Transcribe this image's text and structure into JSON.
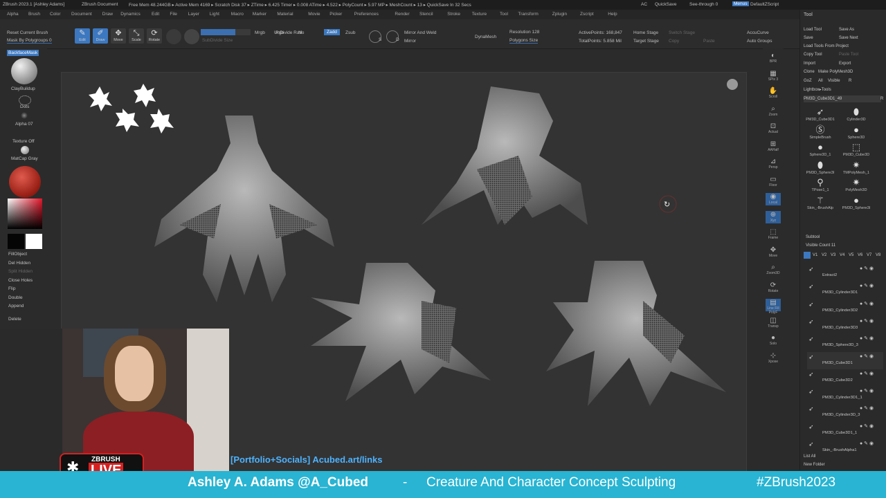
{
  "titlebar": {
    "app": "ZBrush 2023.1 [Ashley Adams]",
    "document": "ZBrush Document",
    "stats": "Free Mem 48.244GB ▸ Active Mem 4169 ▸ Scratch Disk 37 ▸ ZTime ▸ 6.425 Timer ▸ 0.008 ATime ▸ 4.522 ▸ PolyCount ▸ 5.97 MP ▸ MeshCount ▸ 13 ▸ QuickSave In 32 Secs",
    "ac": "AC",
    "quicksave": "QuickSave",
    "seethrough": "See-through 0",
    "menus_btn": "Menus",
    "defaultzscript": "DefaultZScript"
  },
  "menubar": [
    "Alpha",
    "Brush",
    "Color",
    "Document",
    "Draw",
    "Dynamics",
    "Edit",
    "File",
    "Layer",
    "Light",
    "Macro",
    "Marker",
    "Material",
    "Movie",
    "Picker",
    "Preferences",
    "Render",
    "Stencil",
    "Stroke",
    "Texture",
    "Tool",
    "Transform",
    "Zplugin",
    "Zscript",
    "Help"
  ],
  "shelf": {
    "reset_brush": "Reset Current Brush",
    "mask_polygroups": "Mask By Polygroups 0",
    "tools": [
      {
        "icon": "edit-icon",
        "label": "Edit",
        "active": true
      },
      {
        "icon": "draw-icon",
        "label": "Draw",
        "active": true
      },
      {
        "icon": "move-icon",
        "label": "Move",
        "active": false
      },
      {
        "icon": "scale-icon",
        "label": "Scale",
        "active": false
      },
      {
        "icon": "rotate-icon",
        "label": "Rotate",
        "active": false
      }
    ],
    "subdivide": "SubDivide Size",
    "undivide": "UnDivide Ratio",
    "mrgb": "Mrgb",
    "rgb": "Rgb",
    "m": "M",
    "zadd": "Zadd",
    "zsub": "Zsub",
    "s": "S",
    "d": "D",
    "mirror_weld": "Mirror And Weld",
    "mirror": "Mirror",
    "dynamesh": "DynaMesh",
    "resolution": "Resolution 128",
    "polygons_size": "Polygons Size",
    "active_points": "ActivePoints: 168,847",
    "total_points": "TotalPoints: 5.858 Mil",
    "home_stage": "Home Stage",
    "target_stage": "Target Stage",
    "switch_stage": "Switch Stage",
    "copy": "Copy",
    "paste": "Paste",
    "accucurve": "AccuCurve",
    "auto_groups": "Auto Groups"
  },
  "lefttray": {
    "backface": "BackfaceMask",
    "brush": "ClayBuildup",
    "stroke": "Dots",
    "alpha": "Alpha 07",
    "texture": "Texture Off",
    "material": "MatCap Gray",
    "buttons": [
      "FillObject",
      "Del Hidden",
      "Split Hidden",
      "Close Holes",
      "Flip",
      "Double",
      "Append",
      "Delete"
    ]
  },
  "rightcol": [
    "BPR",
    "SPix 3",
    "Scroll",
    "Zoom",
    "Actual",
    "AAHalf",
    "Persp",
    "Floor",
    "Local",
    "Xyz",
    "Frame",
    "Move",
    "Zoom3D",
    "Rotate",
    "Line Fill PolyF",
    "Transp",
    "Solo",
    "Xpose"
  ],
  "toolpanel": {
    "title": "Tool",
    "buttons": [
      "Load Tool",
      "Save As",
      "Save",
      "Save Next",
      "Load Tools From Project",
      "Copy Tool",
      "Paste Tool",
      "Import",
      "Export",
      "Clone",
      "Make PolyMesh3D",
      "GoZ",
      "All",
      "Visible",
      "R",
      "Lightbox▸Tools"
    ],
    "current": "PM3D_Cube3D1_49",
    "current_r": "R",
    "thumbs": [
      "PM3D_Cube3D1",
      "Cylinder3D",
      "SimpleBrush",
      "Sphere3D",
      "Sphere3D_1",
      "PM3D_Cube3D",
      "PM3D_Sphere3I",
      "TMPolyMesh_1",
      "TPose1_1",
      "PolyMesh3D",
      "Skin_-BrushAlp",
      "PM3D_Sphere3I"
    ],
    "subtool_title": "Subtool",
    "visible_count": "Visible Count 11",
    "versions": [
      "V1",
      "V2",
      "V3",
      "V4",
      "V5",
      "V6",
      "V7",
      "V8"
    ],
    "subtools": [
      "Extract2",
      "PM3D_Cylinder3D1",
      "PM3D_Cylinder3D2",
      "PM3D_Cylinder3D3",
      "PM3D_Sphere3D_3",
      "PM3D_Cube3D1",
      "PM3D_Cube3D2",
      "PM3D_Cylinder3D1_1",
      "PM3D_Cylinder3D_3",
      "PM3D_Cube3D1_1",
      "Skin_-BrushAlpha1"
    ],
    "list_all": "List All",
    "new_folder": "New Folder"
  },
  "overlay": {
    "portfolio": "[Portfolio+Socials] Acubed.art/links",
    "live_top": "ZBRUSH",
    "live_bottom": "LIVE"
  },
  "banner": {
    "name": "Ashley A. Adams @A_Cubed",
    "dash": "-",
    "topic": "Creature And Character Concept Sculpting",
    "hashtag": "#ZBrush2023"
  }
}
